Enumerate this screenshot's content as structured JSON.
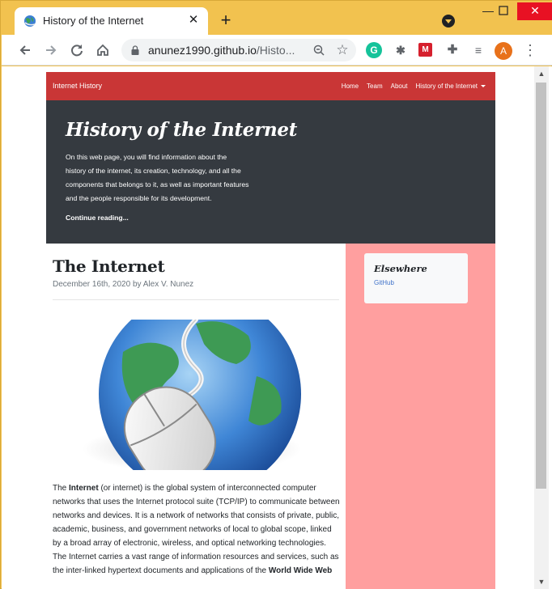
{
  "browser": {
    "tab_title": "History of the Internet",
    "url_host": "anunez1990.github.io",
    "url_path": "/Histo...",
    "avatar_initial": "A",
    "colors": {
      "frame": "#f2c24f",
      "close": "#e81123",
      "avatar": "#e8711a"
    }
  },
  "site": {
    "brand": "Internet History",
    "nav": [
      "Home",
      "Team",
      "About",
      "History of the Internet"
    ],
    "colors": {
      "navbar": "#c93636",
      "hero": "#353a40",
      "sidebar": "#ff9f9f"
    }
  },
  "hero": {
    "title": "History of the Internet",
    "lines": [
      "On this web page, you will find information about the",
      "history of the internet, its creation, technology, and all the",
      "components that belongs to it, as well as important features",
      "and the people responsible for its development."
    ],
    "link": "Continue reading..."
  },
  "post": {
    "title": "The Internet",
    "meta": "December 16th, 2020 by Alex V. Nunez",
    "body_strong_1": "Internet",
    "body_lead": "The",
    "body_after_strong": "(or internet) is the global system of interconnected computer networks that uses the Internet protocol suite (TCP/IP) to communicate between networks and devices. It is a network of networks that consists of private, public, academic, business, and government networks of local to global scope, linked by a broad array of electronic, wireless, and optical networking technologies. The Internet carries a vast range of information resources and services, such as the inter-linked hypertext documents and applications of the",
    "body_strong_2": "World Wide Web"
  },
  "sidebar": {
    "title": "Elsewhere",
    "link": "GitHub"
  }
}
